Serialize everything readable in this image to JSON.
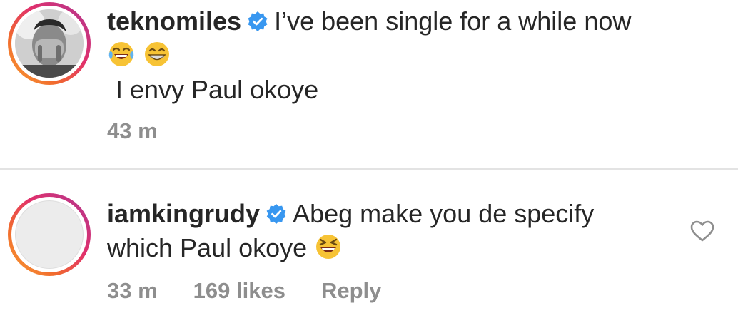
{
  "comments": [
    {
      "username": "teknomiles",
      "verified": true,
      "text_line1": "I’ve been single for a while now",
      "emojis_line": [
        "face-with-tears-of-joy",
        "grinning-face-with-smiling-eyes"
      ],
      "text_line2": "I envy Paul okoye",
      "time": "43 m"
    },
    {
      "username": "iamkingrudy",
      "verified": true,
      "text_line1": "Abeg make you de specify",
      "text_line2": "which Paul okoye",
      "emoji": "grinning-squinting-face",
      "time": "33 m",
      "likes": "169 likes",
      "reply_label": "Reply",
      "like_icon": "heart-outline-icon"
    }
  ],
  "colors": {
    "text": "#262626",
    "meta": "#8e8e8e",
    "verified": "#3897f0",
    "divider": "#e3e3e3"
  }
}
